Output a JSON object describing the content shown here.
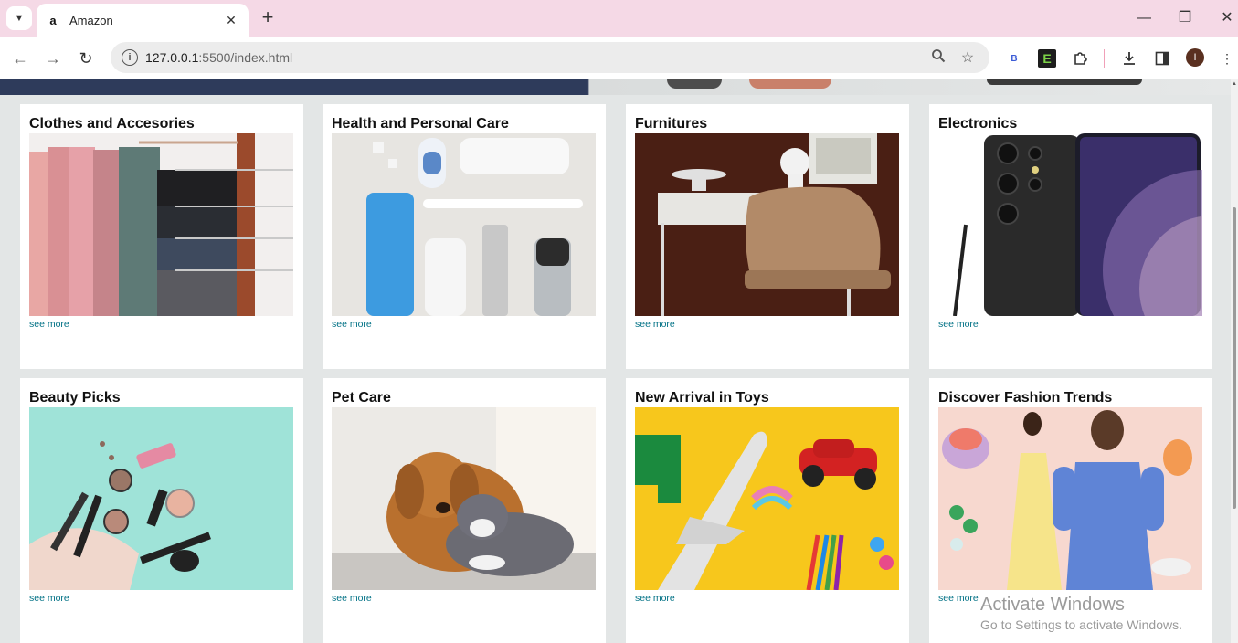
{
  "browser": {
    "tab_title": "Amazon",
    "tab_favicon": "a",
    "url_host": "127.0.0.1",
    "url_rest": ":5500/index.html",
    "avatar_initial": "I",
    "ext_b_label": "B",
    "ext_e_label": "E"
  },
  "cards": [
    {
      "title": "Clothes and Accesories",
      "link": "see more",
      "image": "clothes-hanger-photo"
    },
    {
      "title": "Health and Personal Care",
      "link": "see more",
      "image": "toiletries-photo"
    },
    {
      "title": "Furnitures",
      "link": "see more",
      "image": "desk-chair-photo"
    },
    {
      "title": "Electronics",
      "link": "see more",
      "image": "smartphone-photo"
    },
    {
      "title": "Beauty Picks",
      "link": "see more",
      "image": "makeup-photo"
    },
    {
      "title": "Pet Care",
      "link": "see more",
      "image": "dog-cat-photo"
    },
    {
      "title": "New Arrival in Toys",
      "link": "see more",
      "image": "toys-photo"
    },
    {
      "title": "Discover Fashion Trends",
      "link": "see more",
      "image": "fashion-models-photo"
    }
  ],
  "watermark": {
    "title": "Activate Windows",
    "subtitle": "Go to Settings to activate Windows."
  },
  "colors": {
    "page_bg": "#e3e6e6",
    "link": "#007185",
    "tabbar": "#f5d9e6",
    "hero_dark": "#2e3b5b"
  }
}
